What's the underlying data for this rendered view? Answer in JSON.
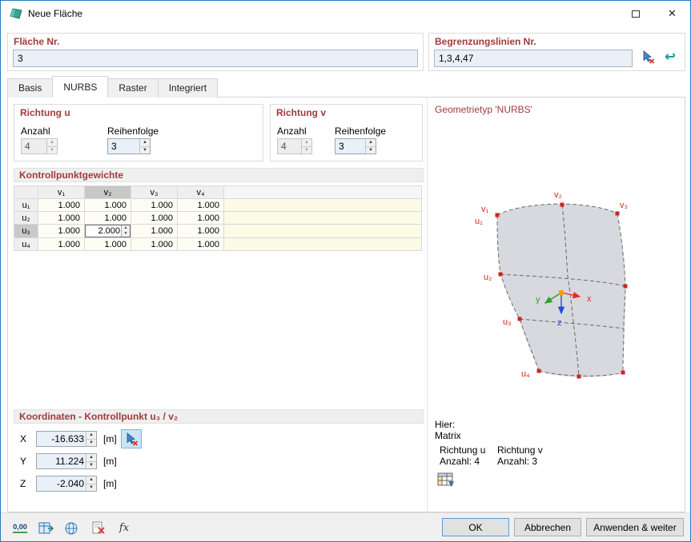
{
  "colors": {
    "header_red": "#9E3B3A",
    "field_blue": "#E9F0F8",
    "selected_gray": "#C8C8C8",
    "cream": "#FBFBE6",
    "window_border_blue": "#2779BF",
    "point_red": "#C8281E",
    "axis_x": "#E03020",
    "axis_y": "#30A030",
    "axis_z": "#2050D0"
  },
  "window": {
    "title": "Neue Fläche"
  },
  "icons": {
    "close": "✕",
    "spin_up": "▲",
    "spin_down": "▼",
    "undo": "↩",
    "fx": "fx",
    "decimal": "0,00"
  },
  "header": {
    "flaeche": {
      "label": "Fläche Nr.",
      "value": "3"
    },
    "begrenzung": {
      "label": "Begrenzungslinien Nr.",
      "value": "1,3,4,47"
    }
  },
  "tabs": [
    {
      "label": "Basis"
    },
    {
      "label": "NURBS"
    },
    {
      "label": "Raster"
    },
    {
      "label": "Integriert"
    }
  ],
  "richtung_u": {
    "title": "Richtung u",
    "anzahl_label": "Anzahl",
    "anzahl": "4",
    "reihenfolge_label": "Reihenfolge",
    "reihenfolge": "3"
  },
  "richtung_v": {
    "title": "Richtung v",
    "anzahl_label": "Anzahl",
    "anzahl": "4",
    "reihenfolge_label": "Reihenfolge",
    "reihenfolge": "3"
  },
  "gewichte": {
    "title": "Kontrollpunktgewichte",
    "cols": [
      "v₁",
      "v₂",
      "v₃",
      "v₄"
    ],
    "rows": [
      "u₁",
      "u₂",
      "u₃",
      "u₄"
    ],
    "values": [
      [
        "1.000",
        "1.000",
        "1.000",
        "1.000"
      ],
      [
        "1.000",
        "1.000",
        "1.000",
        "1.000"
      ],
      [
        "1.000",
        "2.000",
        "1.000",
        "1.000"
      ],
      [
        "1.000",
        "1.000",
        "1.000",
        "1.000"
      ]
    ]
  },
  "koordinaten": {
    "title": "Koordinaten - Kontrollpunkt u₃ / v₂",
    "x": {
      "label": "X",
      "value": "-16.633",
      "unit": "[m]"
    },
    "y": {
      "label": "Y",
      "value": "11.224",
      "unit": "[m]"
    },
    "z": {
      "label": "Z",
      "value": "-2.040",
      "unit": "[m]"
    }
  },
  "preview": {
    "title": "Geometrietyp 'NURBS'",
    "hier": "Hier:",
    "matrix": "Matrix",
    "u_col": {
      "richtung": "Richtung u",
      "anzahl": "Anzahl: 4"
    },
    "v_col": {
      "richtung": "Richtung v",
      "anzahl": "Anzahl: 3"
    },
    "labels": {
      "v1": "v₁",
      "v2": "v₂",
      "v3": "v₃",
      "u1": "u₁",
      "u2": "u₂",
      "u3": "u₃",
      "u4": "u₄",
      "x": "x",
      "y": "y",
      "z": "z"
    }
  },
  "footer": {
    "ok": "OK",
    "cancel": "Abbrechen",
    "apply": "Anwenden & weiter"
  }
}
